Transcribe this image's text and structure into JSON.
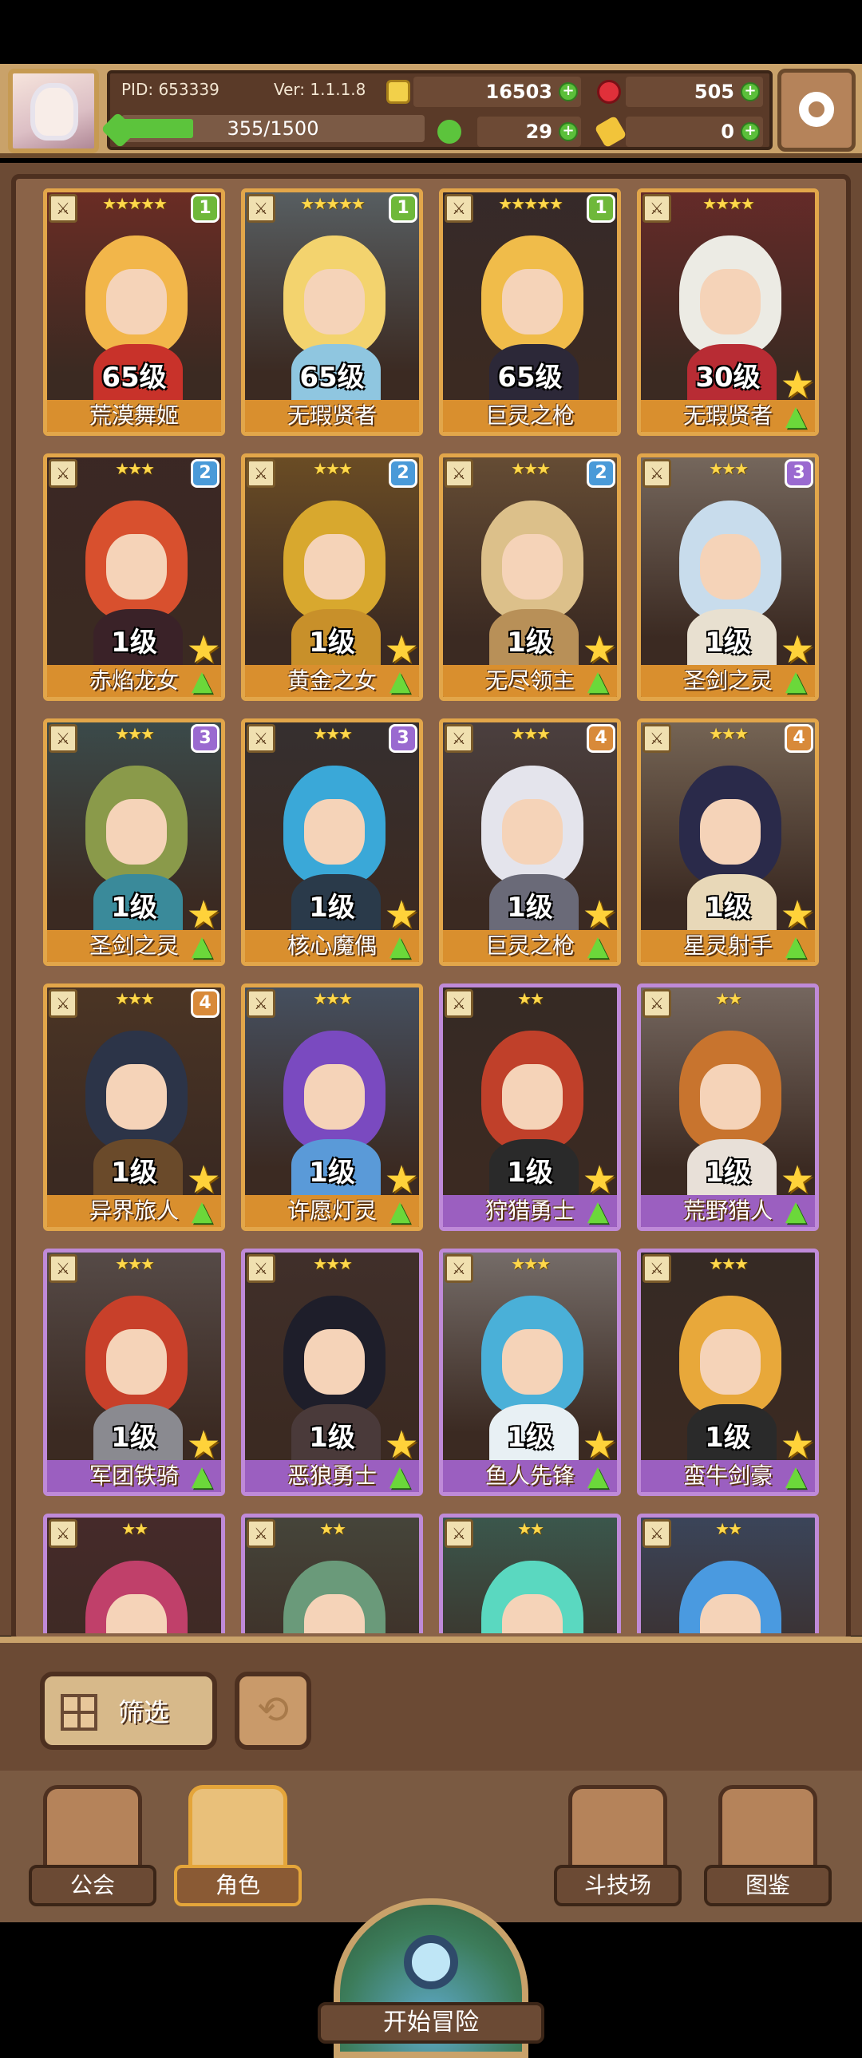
{
  "header": {
    "pid": "PID: 653339",
    "version": "Ver: 1.1.1.8",
    "gold": "16503",
    "gems": "505",
    "clover": "29",
    "key": "0",
    "exp_text": "355/1500",
    "exp_fraction": 0.237
  },
  "cards": [
    {
      "level": "65级",
      "name": "荒漠舞姬",
      "stars": "★★★★★",
      "rank": "1",
      "border": "gold",
      "rank_color": "#6fb83a",
      "hair": "#f2b64a",
      "outfit": "#c8322a",
      "upgrade": false
    },
    {
      "level": "65级",
      "name": "无瑕贤者",
      "stars": "★★★★★",
      "rank": "1",
      "border": "gold",
      "rank_color": "#6fb83a",
      "hair": "#f3d36e",
      "outfit": "#8fc6e0",
      "upgrade": false
    },
    {
      "level": "65级",
      "name": "巨灵之枪",
      "stars": "★★★★★",
      "rank": "1",
      "border": "gold",
      "rank_color": "#6fb83a",
      "hair": "#f0bc4a",
      "outfit": "#2c2838",
      "upgrade": false
    },
    {
      "level": "30级",
      "name": "无瑕贤者",
      "stars": "★★★★",
      "rank": "",
      "border": "gold",
      "rank_color": "",
      "hair": "#ecebe4",
      "outfit": "#b82c34",
      "upgrade": true
    },
    {
      "level": "1级",
      "name": "赤焰龙女",
      "stars": "★★★",
      "rank": "2",
      "border": "gold",
      "rank_color": "#4a9ad8",
      "hair": "#d8502e",
      "outfit": "#3a2228",
      "upgrade": true
    },
    {
      "level": "1级",
      "name": "黄金之女",
      "stars": "★★★",
      "rank": "2",
      "border": "gold",
      "rank_color": "#4a9ad8",
      "hair": "#d8a82e",
      "outfit": "#c8902a",
      "upgrade": true
    },
    {
      "level": "1级",
      "name": "无尽领主",
      "stars": "★★★",
      "rank": "2",
      "border": "gold",
      "rank_color": "#4a9ad8",
      "hair": "#dcc08a",
      "outfit": "#b89058",
      "upgrade": true
    },
    {
      "level": "1级",
      "name": "圣剑之灵",
      "stars": "★★★",
      "rank": "3",
      "border": "gold",
      "rank_color": "#9a6ad0",
      "hair": "#c8dcec",
      "outfit": "#e8e0d0",
      "upgrade": true
    },
    {
      "level": "1级",
      "name": "圣剑之灵",
      "stars": "★★★",
      "rank": "3",
      "border": "gold",
      "rank_color": "#9a6ad0",
      "hair": "#8a9a4a",
      "outfit": "#3a8a9a",
      "upgrade": true
    },
    {
      "level": "1级",
      "name": "核心魔偶",
      "stars": "★★★",
      "rank": "3",
      "border": "gold",
      "rank_color": "#9a6ad0",
      "hair": "#3aa8d8",
      "outfit": "#2a3a4a",
      "upgrade": true
    },
    {
      "level": "1级",
      "name": "巨灵之枪",
      "stars": "★★★",
      "rank": "4",
      "border": "gold",
      "rank_color": "#d88a3a",
      "hair": "#e4e4ec",
      "outfit": "#6a6a78",
      "upgrade": true
    },
    {
      "level": "1级",
      "name": "星灵射手",
      "stars": "★★★",
      "rank": "4",
      "border": "gold",
      "rank_color": "#d88a3a",
      "hair": "#2a2a4a",
      "outfit": "#e8d8b8",
      "upgrade": true
    },
    {
      "level": "1级",
      "name": "异界旅人",
      "stars": "★★★",
      "rank": "4",
      "border": "gold",
      "rank_color": "#d88a3a",
      "hair": "#2c3448",
      "outfit": "#6a4a2a",
      "upgrade": true
    },
    {
      "level": "1级",
      "name": "许愿灯灵",
      "stars": "★★★",
      "rank": "",
      "border": "gold",
      "rank_color": "",
      "hair": "#7a4ac0",
      "outfit": "#5a9ad8",
      "upgrade": true
    },
    {
      "level": "1级",
      "name": "狩猎勇士",
      "stars": "★★",
      "rank": "",
      "border": "purple",
      "rank_color": "",
      "hair": "#c0402a",
      "outfit": "#2a2a2a",
      "upgrade": true
    },
    {
      "level": "1级",
      "name": "荒野猎人",
      "stars": "★★",
      "rank": "",
      "border": "purple",
      "rank_color": "",
      "hair": "#c8742e",
      "outfit": "#e8e0d8",
      "upgrade": true
    },
    {
      "level": "1级",
      "name": "军团铁骑",
      "stars": "★★★",
      "rank": "",
      "border": "purple",
      "rank_color": "",
      "hair": "#c8402a",
      "outfit": "#8a8a90",
      "upgrade": true
    },
    {
      "level": "1级",
      "name": "恶狼勇士",
      "stars": "★★★",
      "rank": "",
      "border": "purple",
      "rank_color": "",
      "hair": "#1e1e2a",
      "outfit": "#4a3a3a",
      "upgrade": true
    },
    {
      "level": "1级",
      "name": "鱼人先锋",
      "stars": "★★★",
      "rank": "",
      "border": "purple",
      "rank_color": "",
      "hair": "#4ab0d8",
      "outfit": "#e8f0f4",
      "upgrade": true
    },
    {
      "level": "1级",
      "name": "蛮牛剑豪",
      "stars": "★★★",
      "rank": "",
      "border": "purple",
      "rank_color": "",
      "hair": "#e8a83a",
      "outfit": "#2a2a2a",
      "upgrade": true
    },
    {
      "level": "",
      "name": "",
      "stars": "★★",
      "rank": "",
      "border": "purple",
      "rank_color": "",
      "hair": "#c0406a",
      "outfit": "#5a2a3a",
      "upgrade": false
    },
    {
      "level": "",
      "name": "",
      "stars": "★★",
      "rank": "",
      "border": "purple",
      "rank_color": "",
      "hair": "#6a9a7a",
      "outfit": "#5a7a6a",
      "upgrade": false
    },
    {
      "level": "",
      "name": "",
      "stars": "★★",
      "rank": "",
      "border": "purple",
      "rank_color": "",
      "hair": "#5ad8c0",
      "outfit": "#3ab0a0",
      "upgrade": false
    },
    {
      "level": "",
      "name": "",
      "stars": "★★",
      "rank": "",
      "border": "purple",
      "rank_color": "",
      "hair": "#4a9ae0",
      "outfit": "#3a7ac8",
      "upgrade": false
    }
  ],
  "toolbar": {
    "filter_label": "筛选"
  },
  "nav": {
    "guild": "公会",
    "character": "角色",
    "adventure": "开始冒险",
    "arena": "斗技场",
    "codex": "图鉴"
  }
}
